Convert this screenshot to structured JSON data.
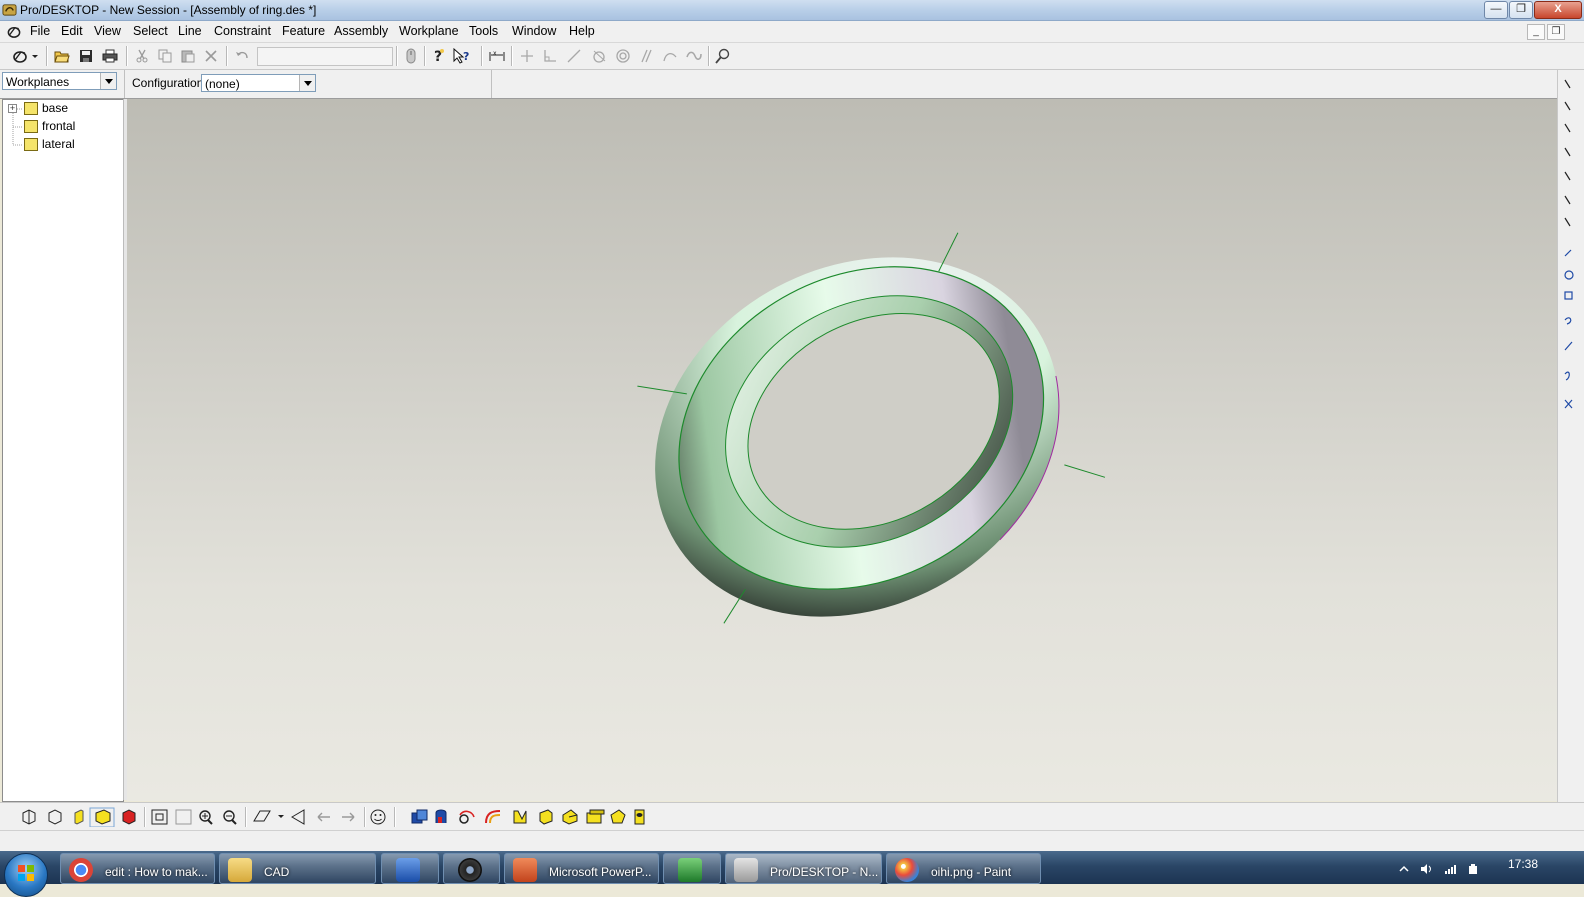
{
  "window": {
    "title": "Pro/DESKTOP - New Session - [Assembly of ring.des *]",
    "minimize_label": "—",
    "maximize_label": "❐",
    "close_label": "X"
  },
  "menubar": {
    "items": [
      "File",
      "Edit",
      "View",
      "Select",
      "Line",
      "Constraint",
      "Feature",
      "Assembly",
      "Workplane",
      "Tools",
      "Window",
      "Help"
    ],
    "mdi_minimize": "_",
    "mdi_restore": "❐"
  },
  "toolbar": {
    "icons": [
      "pro-desktop-menu-icon",
      "open-folder-icon",
      "save-icon",
      "print-icon",
      "cut-icon",
      "copy-icon",
      "paste-icon",
      "delete-icon",
      "undo-icon",
      "cursor-mode-icon",
      "help-icon",
      "context-help-icon",
      "dimension-icon",
      "constraint-perpendicular-icon",
      "constraint-angle-icon",
      "constraint-tangent-icon",
      "constraint-circle-icon",
      "constraint-concentric-icon",
      "constraint-parallel-icon",
      "constraint-fix-icon",
      "constraint-link-icon",
      "find-icon"
    ]
  },
  "browser": {
    "selector_value": "Workplanes",
    "configuration_label": "Configuration:",
    "configuration_value": "(none)",
    "tree": [
      {
        "label": "base"
      },
      {
        "label": "frontal"
      },
      {
        "label": "lateral"
      }
    ]
  },
  "view_toolbar": {
    "icons": [
      "isometric-view-icon",
      "trimetric-view-icon",
      "shaded-view-icon",
      "shaded-edges-view-icon",
      "rendered-view-icon",
      "zoom-fit-icon",
      "zoom-window-icon",
      "zoom-in-icon",
      "zoom-out-icon",
      "view-plane-icon",
      "perspective-icon",
      "previous-view-icon",
      "next-view-icon",
      "smiley-icon",
      "feature-extrude-icon",
      "feature-revolve-icon",
      "feature-sweep-icon",
      "feature-loft-icon",
      "feature-shell-icon",
      "feature-pattern-icon",
      "feature-chamfer-icon",
      "feature-blend-icon",
      "feature-draft-icon",
      "feature-hole-icon"
    ]
  },
  "colors": {
    "ring_face": "#c9f0cf",
    "ring_edge": "#1d8a2c",
    "ring_side": "#ece8f0",
    "highlight_edge": "#a02aa0",
    "viewport_top": "#bdbcb4",
    "viewport_bottom": "#eae9e2"
  },
  "taskbar": {
    "items": [
      {
        "label": "edit : How to mak...",
        "icon": "chrome-icon"
      },
      {
        "label": "CAD",
        "icon": "folder-icon"
      },
      {
        "label": "",
        "icon": "word-icon"
      },
      {
        "label": "",
        "icon": "webcam-icon"
      },
      {
        "label": "Microsoft PowerP...",
        "icon": "powerpoint-icon"
      },
      {
        "label": "",
        "icon": "excel-icon"
      },
      {
        "label": "Pro/DESKTOP - N...",
        "icon": "pro-desktop-icon"
      },
      {
        "label": "oihi.png - Paint",
        "icon": "paint-icon"
      }
    ],
    "clock": "17:38"
  }
}
